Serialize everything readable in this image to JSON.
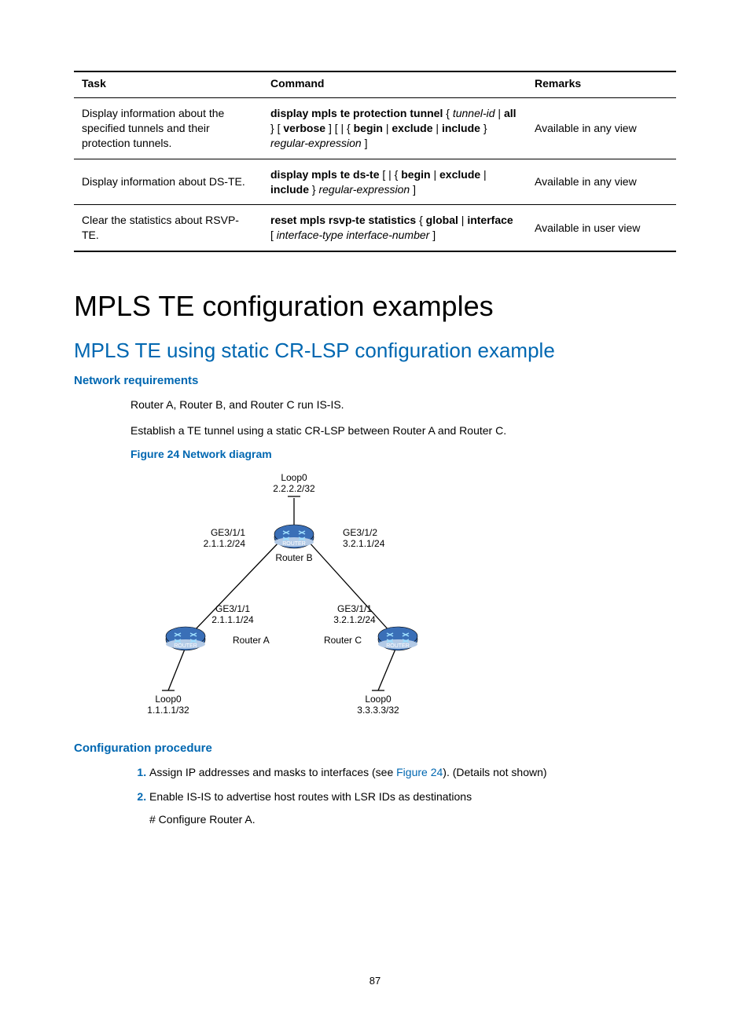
{
  "table": {
    "headers": {
      "task": "Task",
      "command": "Command",
      "remarks": "Remarks"
    },
    "rows": [
      {
        "task": "Display information about the specified tunnels and their protection tunnels.",
        "cmd_parts": {
          "p1": "display mpls te protection tunnel",
          "p2": " { ",
          "p3": "tunnel-id",
          "p4": " | ",
          "p5": "all",
          "p6": " } [ ",
          "p7": "verbose",
          "p8": " ] [ | { ",
          "p9": "begin",
          "p10": " | ",
          "p11": "exclude",
          "p12": " | ",
          "p13": "include",
          "p14": " } ",
          "p15": "regular-expression",
          "p16": " ]"
        },
        "remarks": "Available in any view"
      },
      {
        "task": "Display information about DS-TE.",
        "cmd_parts": {
          "p1": "display mpls te ds-te",
          "p2": " [ | { ",
          "p3": "begin",
          "p4": " | ",
          "p5": "exclude",
          "p6": " | ",
          "p7": "include",
          "p8": " } ",
          "p9": "regular-expression",
          "p10": " ]"
        },
        "remarks": "Available in any view"
      },
      {
        "task": "Clear the statistics about RSVP-TE.",
        "cmd_parts": {
          "p1": "reset mpls rsvp-te statistics",
          "p2": " { ",
          "p3": "global",
          "p4": " | ",
          "p5": "interface",
          "p6": " [ ",
          "p7": "interface-type interface-number",
          "p8": " ]"
        },
        "remarks": "Available in user view"
      }
    ]
  },
  "headings": {
    "title": "MPLS TE configuration examples",
    "section": "MPLS TE using static CR-LSP configuration example",
    "netreq": "Network requirements",
    "figcap": "Figure 24 Network diagram",
    "confproc": "Configuration procedure"
  },
  "body": {
    "p1": "Router A, Router B, and Router C run IS-IS.",
    "p2": "Establish a TE tunnel using a static CR-LSP between Router A and Router C."
  },
  "diagram": {
    "routerB": {
      "name": "Router B",
      "loop": "Loop0",
      "loop_addr": "2.2.2.2/32",
      "left_if": "GE3/1/1",
      "left_addr": "2.1.1.2/24",
      "right_if": "GE3/1/2",
      "right_addr": "3.2.1.1/24"
    },
    "routerA": {
      "name": "Router A",
      "if": "GE3/1/1",
      "addr": "2.1.1.1/24",
      "loop": "Loop0",
      "loop_addr": "1.1.1.1/32"
    },
    "routerC": {
      "name": "Router C",
      "if": "GE3/1/1",
      "addr": "3.2.1.2/24",
      "loop": "Loop0",
      "loop_addr": "3.3.3.3/32"
    }
  },
  "procedure": {
    "step1_a": "Assign IP addresses and masks to interfaces (see ",
    "step1_link": "Figure 24",
    "step1_b": "). (Details not shown)",
    "step2": "Enable IS-IS to advertise host routes with LSR IDs as destinations",
    "step2_sub": "# Configure Router A."
  },
  "page_number": "87"
}
